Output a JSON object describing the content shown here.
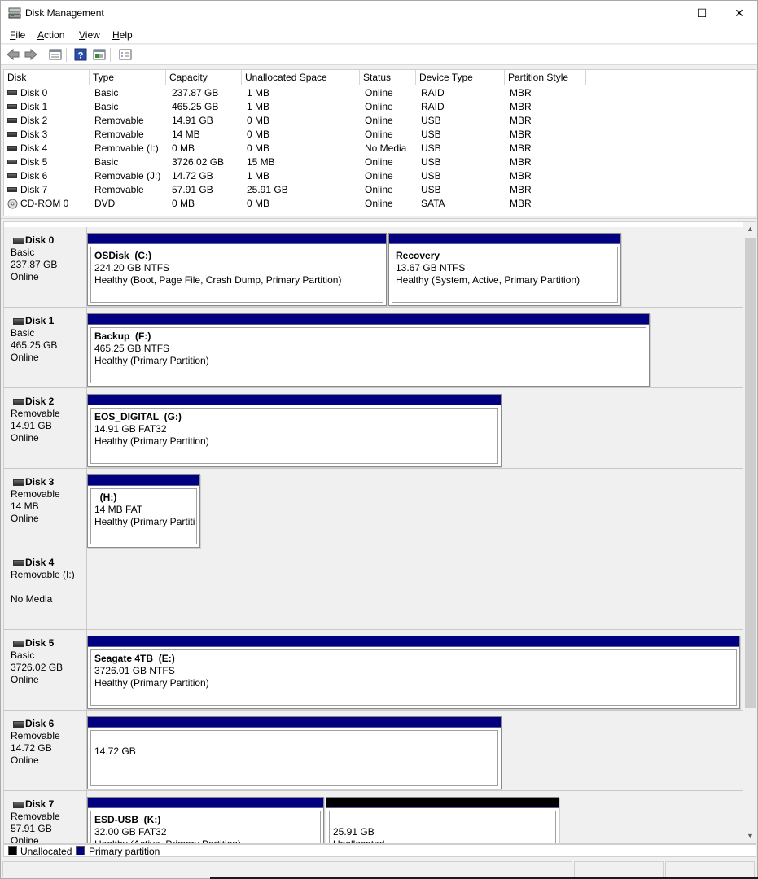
{
  "window": {
    "title": "Disk Management",
    "min_glyph": "—",
    "max_glyph": "☐",
    "close_glyph": "✕"
  },
  "menu": [
    {
      "accel": "F",
      "rest": "ile"
    },
    {
      "accel": "A",
      "rest": "ction"
    },
    {
      "accel": "V",
      "rest": "iew"
    },
    {
      "accel": "H",
      "rest": "elp"
    }
  ],
  "toolbar_icons": [
    "back-icon",
    "forward-icon",
    "properties-list-icon",
    "help-icon",
    "disk-view-icon",
    "checklist-icon"
  ],
  "columns": [
    "Disk",
    "Type",
    "Capacity",
    "Unallocated Space",
    "Status",
    "Device Type",
    "Partition Style"
  ],
  "disks_list": [
    {
      "disk": "Disk 0",
      "type": "Basic",
      "capacity": "237.87 GB",
      "unalloc": "1 MB",
      "status": "Online",
      "device": "RAID",
      "style": "MBR"
    },
    {
      "disk": "Disk 1",
      "type": "Basic",
      "capacity": "465.25 GB",
      "unalloc": "1 MB",
      "status": "Online",
      "device": "RAID",
      "style": "MBR"
    },
    {
      "disk": "Disk 2",
      "type": "Removable",
      "capacity": "14.91 GB",
      "unalloc": "0 MB",
      "status": "Online",
      "device": "USB",
      "style": "MBR"
    },
    {
      "disk": "Disk 3",
      "type": "Removable",
      "capacity": "14 MB",
      "unalloc": "0 MB",
      "status": "Online",
      "device": "USB",
      "style": "MBR"
    },
    {
      "disk": "Disk 4",
      "type": "Removable (I:)",
      "capacity": "0 MB",
      "unalloc": "0 MB",
      "status": "No Media",
      "device": "USB",
      "style": "MBR"
    },
    {
      "disk": "Disk 5",
      "type": "Basic",
      "capacity": "3726.02 GB",
      "unalloc": "15 MB",
      "status": "Online",
      "device": "USB",
      "style": "MBR"
    },
    {
      "disk": "Disk 6",
      "type": "Removable (J:)",
      "capacity": "14.72 GB",
      "unalloc": "1 MB",
      "status": "Online",
      "device": "USB",
      "style": "MBR"
    },
    {
      "disk": "Disk 7",
      "type": "Removable",
      "capacity": "57.91 GB",
      "unalloc": "25.91 GB",
      "status": "Online",
      "device": "USB",
      "style": "MBR"
    },
    {
      "disk": "CD-ROM 0",
      "type": "DVD",
      "capacity": "0 MB",
      "unalloc": "0 MB",
      "status": "Online",
      "device": "SATA",
      "style": "MBR"
    }
  ],
  "graphical": [
    {
      "name": "Disk 0",
      "type": "Basic",
      "size": "237.87 GB",
      "state": "Online",
      "partitions": [
        {
          "title": "OSDisk  (C:)",
          "size_fs": "224.20 GB NTFS",
          "status": "Healthy (Boot, Page File, Crash Dump, Primary Partition)",
          "kind": "primary"
        },
        {
          "title": "Recovery",
          "size_fs": "13.67 GB NTFS",
          "status": "Healthy (System, Active, Primary Partition)",
          "kind": "primary"
        }
      ]
    },
    {
      "name": "Disk 1",
      "type": "Basic",
      "size": "465.25 GB",
      "state": "Online",
      "partitions": [
        {
          "title": "Backup  (F:)",
          "size_fs": "465.25 GB NTFS",
          "status": "Healthy (Primary Partition)",
          "kind": "primary"
        }
      ]
    },
    {
      "name": "Disk 2",
      "type": "Removable",
      "size": "14.91 GB",
      "state": "Online",
      "partitions": [
        {
          "title": "EOS_DIGITAL  (G:)",
          "size_fs": "14.91 GB FAT32",
          "status": "Healthy (Primary Partition)",
          "kind": "primary"
        }
      ]
    },
    {
      "name": "Disk 3",
      "type": "Removable",
      "size": "14 MB",
      "state": "Online",
      "partitions": [
        {
          "title": "  (H:)",
          "size_fs": "14 MB FAT",
          "status": "Healthy (Primary Partiti",
          "kind": "primary"
        }
      ]
    },
    {
      "name": "Disk 4",
      "type": "Removable (I:)",
      "size": "",
      "state": "No Media",
      "partitions": []
    },
    {
      "name": "Disk 5",
      "type": "Basic",
      "size": "3726.02 GB",
      "state": "Online",
      "partitions": [
        {
          "title": "Seagate 4TB  (E:)",
          "size_fs": "3726.01 GB NTFS",
          "status": "Healthy (Primary Partition)",
          "kind": "primary"
        }
      ]
    },
    {
      "name": "Disk 6",
      "type": "Removable",
      "size": "14.72 GB",
      "state": "Online",
      "partitions": [
        {
          "title": "",
          "size_fs": "14.72 GB",
          "status": "",
          "kind": "primary"
        }
      ]
    },
    {
      "name": "Disk 7",
      "type": "Removable",
      "size": "57.91 GB",
      "state": "Online",
      "partitions": [
        {
          "title": "ESD-USB  (K:)",
          "size_fs": "32.00 GB FAT32",
          "status": "Healthy (Active, Primary Partition)",
          "kind": "primary"
        },
        {
          "title": "",
          "size_fs": "25.91 GB",
          "status": "Unallocated",
          "kind": "unallocated"
        }
      ]
    }
  ],
  "legend": {
    "unallocated": "Unallocated",
    "primary": "Primary partition"
  },
  "colors": {
    "primary": "#000080",
    "unallocated": "#000000"
  }
}
